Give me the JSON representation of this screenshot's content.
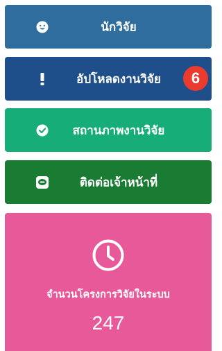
{
  "menu": {
    "researcher": {
      "label": "นักวิจัย",
      "icon": "smiley-icon"
    },
    "upload": {
      "label": "อัปโหลดงานวิจัย",
      "icon": "exclamation-icon",
      "badge": "6"
    },
    "status": {
      "label": "สถานภาพงานวิจัย",
      "icon": "check-circle-icon"
    },
    "contact": {
      "label": "ติดต่อเจ้าหน้าที่",
      "icon": "line-chat-icon"
    }
  },
  "stats": {
    "icon": "clock-icon",
    "caption": "จำนวนโครงการวิจัยในระบบ",
    "count": "247"
  },
  "colors": {
    "researcher": "#2e6d9d",
    "upload": "#1f4f8b",
    "status": "#17ad78",
    "contact": "#1a7b33",
    "badge": "#ea3b2e",
    "stat_card": "#e8599a"
  }
}
